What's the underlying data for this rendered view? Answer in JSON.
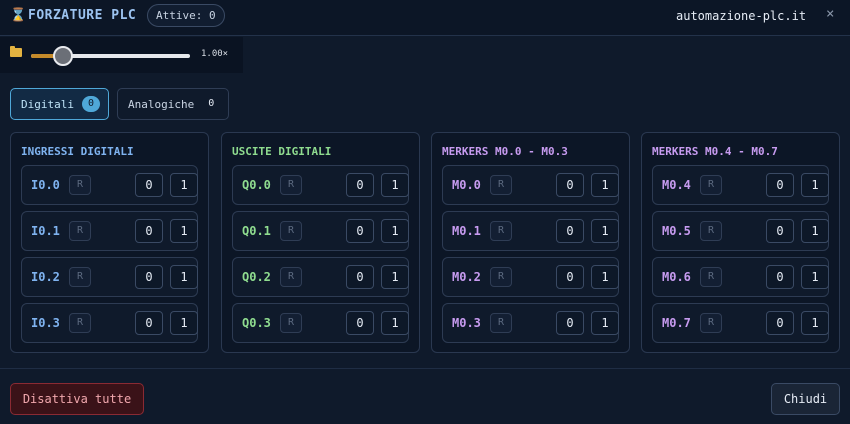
{
  "header": {
    "icon": "hourglass-icon",
    "title": "FORZATURE PLC",
    "active_badge": "Attive: 0",
    "site": "automazione-plc.it",
    "close_glyph": "×"
  },
  "toolbar": {
    "folder_icon": "folder-icon",
    "zoom_value": 1.0,
    "zoom_label": "1.00×"
  },
  "tabs": [
    {
      "label": "Digitali",
      "count": "0",
      "active": true
    },
    {
      "label": "Analogiche",
      "count": "0",
      "active": false
    }
  ],
  "colors": {
    "inputs": "#7fb3f0",
    "outputs": "#8fdc8f",
    "merkers": "#c79bf0"
  },
  "panels": [
    {
      "title": "INGRESSI DIGITALI",
      "kind": "inputs",
      "rows": [
        {
          "label": "I0.0",
          "r": "R",
          "v0": "0",
          "v1": "1"
        },
        {
          "label": "I0.1",
          "r": "R",
          "v0": "0",
          "v1": "1"
        },
        {
          "label": "I0.2",
          "r": "R",
          "v0": "0",
          "v1": "1"
        },
        {
          "label": "I0.3",
          "r": "R",
          "v0": "0",
          "v1": "1"
        }
      ]
    },
    {
      "title": "USCITE DIGITALI",
      "kind": "outputs",
      "rows": [
        {
          "label": "Q0.0",
          "r": "R",
          "v0": "0",
          "v1": "1"
        },
        {
          "label": "Q0.1",
          "r": "R",
          "v0": "0",
          "v1": "1"
        },
        {
          "label": "Q0.2",
          "r": "R",
          "v0": "0",
          "v1": "1"
        },
        {
          "label": "Q0.3",
          "r": "R",
          "v0": "0",
          "v1": "1"
        }
      ]
    },
    {
      "title": "MERKERS M0.0 - M0.3",
      "kind": "merkers",
      "rows": [
        {
          "label": "M0.0",
          "r": "R",
          "v0": "0",
          "v1": "1"
        },
        {
          "label": "M0.1",
          "r": "R",
          "v0": "0",
          "v1": "1"
        },
        {
          "label": "M0.2",
          "r": "R",
          "v0": "0",
          "v1": "1"
        },
        {
          "label": "M0.3",
          "r": "R",
          "v0": "0",
          "v1": "1"
        }
      ]
    },
    {
      "title": "MERKERS M0.4 - M0.7",
      "kind": "merkers",
      "rows": [
        {
          "label": "M0.4",
          "r": "R",
          "v0": "0",
          "v1": "1"
        },
        {
          "label": "M0.5",
          "r": "R",
          "v0": "0",
          "v1": "1"
        },
        {
          "label": "M0.6",
          "r": "R",
          "v0": "0",
          "v1": "1"
        },
        {
          "label": "M0.7",
          "r": "R",
          "v0": "0",
          "v1": "1"
        }
      ]
    }
  ],
  "footer": {
    "disable_all": "Disattiva tutte",
    "close": "Chiudi"
  }
}
